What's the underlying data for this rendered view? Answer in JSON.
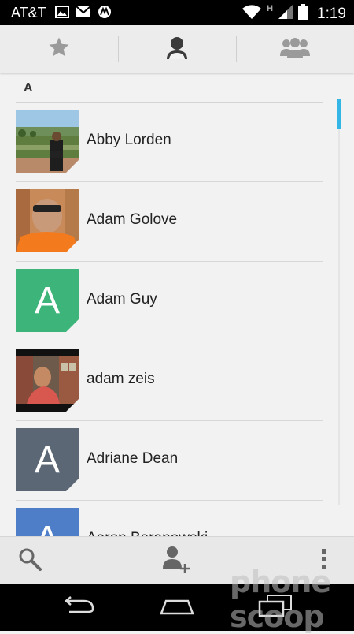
{
  "status_bar": {
    "carrier": "AT&T",
    "network_type": "H",
    "time": "1:19",
    "icons": [
      "image-icon",
      "gmail-icon",
      "motorola-icon",
      "wifi-icon",
      "signal-icon",
      "battery-icon"
    ]
  },
  "tabs": [
    {
      "icon": "star-icon",
      "name": "tab-favorites",
      "selected": false
    },
    {
      "icon": "person-icon",
      "name": "tab-contacts",
      "selected": true
    },
    {
      "icon": "group-icon",
      "name": "tab-groups",
      "selected": false
    }
  ],
  "list": {
    "section": "A",
    "scroll_position": 0.0,
    "contacts": [
      {
        "name": "Abby Lorden",
        "avatar_type": "photo"
      },
      {
        "name": "Adam Golove",
        "avatar_type": "photo"
      },
      {
        "name": "Adam Guy",
        "avatar_type": "letter",
        "letter": "A",
        "color": "#3db57a"
      },
      {
        "name": "adam zeis",
        "avatar_type": "photo"
      },
      {
        "name": "Adriane Dean",
        "avatar_type": "letter",
        "letter": "A",
        "color": "#5b6775"
      },
      {
        "name": "Aaron Baranowski",
        "avatar_type": "letter",
        "letter": "A",
        "color": "#4e7ec7"
      }
    ]
  },
  "bottom_actions": [
    "search-icon",
    "add-contact-icon",
    "overflow-menu-icon"
  ],
  "nav_buttons": [
    "back-icon",
    "home-icon",
    "recents-icon"
  ],
  "watermark": "phone scoop",
  "colors": {
    "accent": "#33b5e5",
    "background": "#f2f2f2",
    "status_bar": "#000000"
  }
}
